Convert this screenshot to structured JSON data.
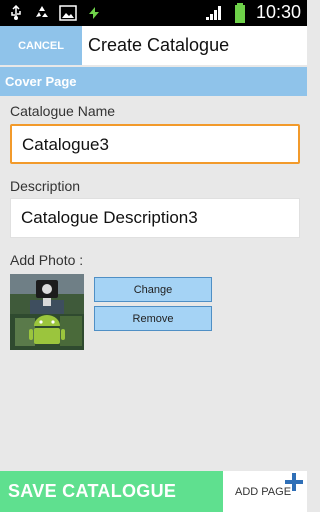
{
  "status_bar": {
    "icons": [
      "usb-icon",
      "recycle-icon",
      "image-icon",
      "sync-icon",
      "signal-icon",
      "battery-icon"
    ],
    "time": "10:30"
  },
  "header": {
    "cancel_label": "CANCEL",
    "title": "Create Catalogue"
  },
  "section": {
    "title": "Cover Page"
  },
  "form": {
    "name_label": "Catalogue Name",
    "name_value": "Catalogue3",
    "description_label": "Description",
    "description_value": "Catalogue Description3",
    "photo_label": "Add Photo :",
    "change_label": "Change",
    "remove_label": "Remove"
  },
  "footer": {
    "save_label": "SAVE CATALOGUE",
    "add_page_label": "ADD PAGE"
  },
  "colors": {
    "accent_blue": "#8fc3ea",
    "save_green": "#5fe08f",
    "focus_orange": "#f29a2b",
    "plus_blue": "#2f6fb7"
  }
}
